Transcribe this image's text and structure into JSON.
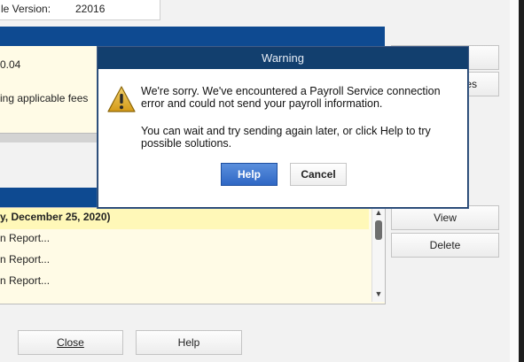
{
  "version_field": {
    "label": "le Version:",
    "value": "22016"
  },
  "background_panel": {
    "amount_text": "0.04",
    "fees_text": "ing applicable fees"
  },
  "list": {
    "rows": [
      "y, December 25, 2020)",
      "n Report...",
      "n Report...",
      "n Report..."
    ]
  },
  "side_buttons": {
    "partial_label": "es",
    "view_label": "View",
    "delete_label": "Delete"
  },
  "bottom_buttons": {
    "close_label": "Close",
    "help_label": "Help"
  },
  "dialog": {
    "title": "Warning",
    "message_1": "We're sorry. We've encountered a Payroll Service connection error and could not send your payroll information.",
    "message_2": "You can wait and try sending again later, or click Help to try possible solutions.",
    "help_label": "Help",
    "cancel_label": "Cancel",
    "icon": "warning-triangle-icon"
  },
  "colors": {
    "header_blue": "#0e4a91",
    "dialog_title": "#123f6e",
    "list_background": "#fffbe6",
    "selected_row": "#fff8b8",
    "primary_button": "#2f67c4"
  }
}
